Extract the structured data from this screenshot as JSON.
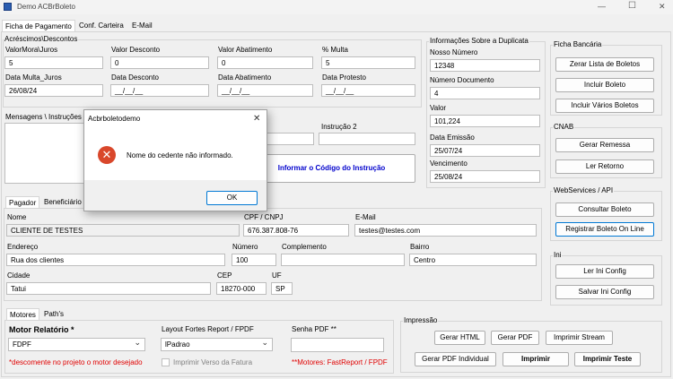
{
  "window": {
    "title": "Demo ACBrBoleto",
    "minimize_glyph": "—",
    "maximize_glyph": "☐",
    "close_glyph": "✕"
  },
  "main_tabs": [
    "Ficha de Pagamento",
    "Conf. Carteira",
    "E-Mail"
  ],
  "acrescimos": {
    "title": "Acréscimos\\Descontos",
    "valor_mora_label": "ValorMora\\Juros",
    "valor_mora_value": "5",
    "valor_desconto_label": "Valor Desconto",
    "valor_desconto_value": "0",
    "valor_abatimento_label": "Valor Abatimento",
    "valor_abatimento_value": "0",
    "multa_label": "% Multa",
    "multa_value": "5",
    "data_multa_label": "Data Multa_Juros",
    "data_multa_value": "26/08/24",
    "data_desconto_label": "Data Desconto",
    "data_desconto_value": "__/__/__",
    "data_abatimento_label": "Data Abatimento",
    "data_abatimento_value": "__/__/__",
    "data_protesto_label": "Data Protesto",
    "data_protesto_value": "__/__/__"
  },
  "mensagens": {
    "label": "Mensagens \\ Instruções",
    "instrucao2_label": "Instrução 2",
    "informar_button": "Informar o Código do Instrução"
  },
  "duplicata": {
    "title": "Informações Sobre a Duplicata",
    "nosso_numero_label": "Nosso Número",
    "nosso_numero_value": "12348",
    "numero_documento_label": "Número Documento",
    "numero_documento_value": "4",
    "valor_label": "Valor",
    "valor_value": "101,224",
    "data_emissao_label": "Data Emissão",
    "data_emissao_value": "25/07/24",
    "vencimento_label": "Vencimento",
    "vencimento_value": "25/08/24"
  },
  "ficha_bancaria": {
    "title": "Ficha Bancária",
    "buttons": [
      "Zerar Lista de Boletos",
      "Incluir Boleto",
      "Incluir Vários Boletos"
    ]
  },
  "cnab": {
    "title": "CNAB",
    "buttons": [
      "Gerar Remessa",
      "Ler Retorno"
    ]
  },
  "webservices": {
    "title": "WebServices / API",
    "buttons": [
      "Consultar Boleto",
      "Registrar Boleto On Line"
    ]
  },
  "ini": {
    "title": "Ini",
    "buttons": [
      "Ler Ini Config",
      "Salvar Ini Config"
    ]
  },
  "pagador_tabs": [
    "Pagador",
    "Beneficiário"
  ],
  "pagador": {
    "nome_label": "Nome",
    "nome_value": "CLIENTE DE TESTES",
    "cpf_label": "CPF / CNPJ",
    "cpf_value": "676.387.808-76",
    "email_label": "E-Mail",
    "email_value": "testes@testes.com",
    "endereco_label": "Endereço",
    "endereco_value": "Rua dos clientes",
    "numero_label": "Número",
    "numero_value": "100",
    "complemento_label": "Complemento",
    "complemento_value": "",
    "bairro_label": "Bairro",
    "bairro_value": "Centro",
    "cidade_label": "Cidade",
    "cidade_value": "Tatui",
    "cep_label": "CEP",
    "cep_value": "18270-000",
    "uf_label": "UF",
    "uf_value": "SP"
  },
  "motores_tabs": [
    "Motores",
    "Path's"
  ],
  "motores": {
    "motor_label": "Motor Relatório *",
    "motor_value": "FDPF",
    "motor_note": "*descomente no projeto o motor desejado",
    "layout_label": "Layout Fortes Report / FPDF",
    "layout_value": "lPadrao",
    "imprimir_verso_label": "Imprimir Verso da Fatura",
    "senha_label": "Senha PDF **",
    "senha_value": "",
    "senha_note": "**Motores: FastReport / FPDF"
  },
  "impressao": {
    "title": "Impressão",
    "gerar_html": "Gerar HTML",
    "gerar_pdf": "Gerar PDF",
    "imprimir_stream": "Imprimir Stream",
    "gerar_pdf_individual": "Gerar PDF Individual",
    "imprimir": "Imprimir",
    "imprimir_teste": "Imprimir Teste"
  },
  "dialog": {
    "title": "Acbrboletodemo",
    "message": "Nome do cedente não informado.",
    "ok": "OK",
    "icon": "error-icon",
    "close_glyph": "✕"
  },
  "colors": {
    "error_red": "#d9472b",
    "link_blue": "#0000cc",
    "note_red": "#e00000",
    "accent": "#0078d4"
  }
}
